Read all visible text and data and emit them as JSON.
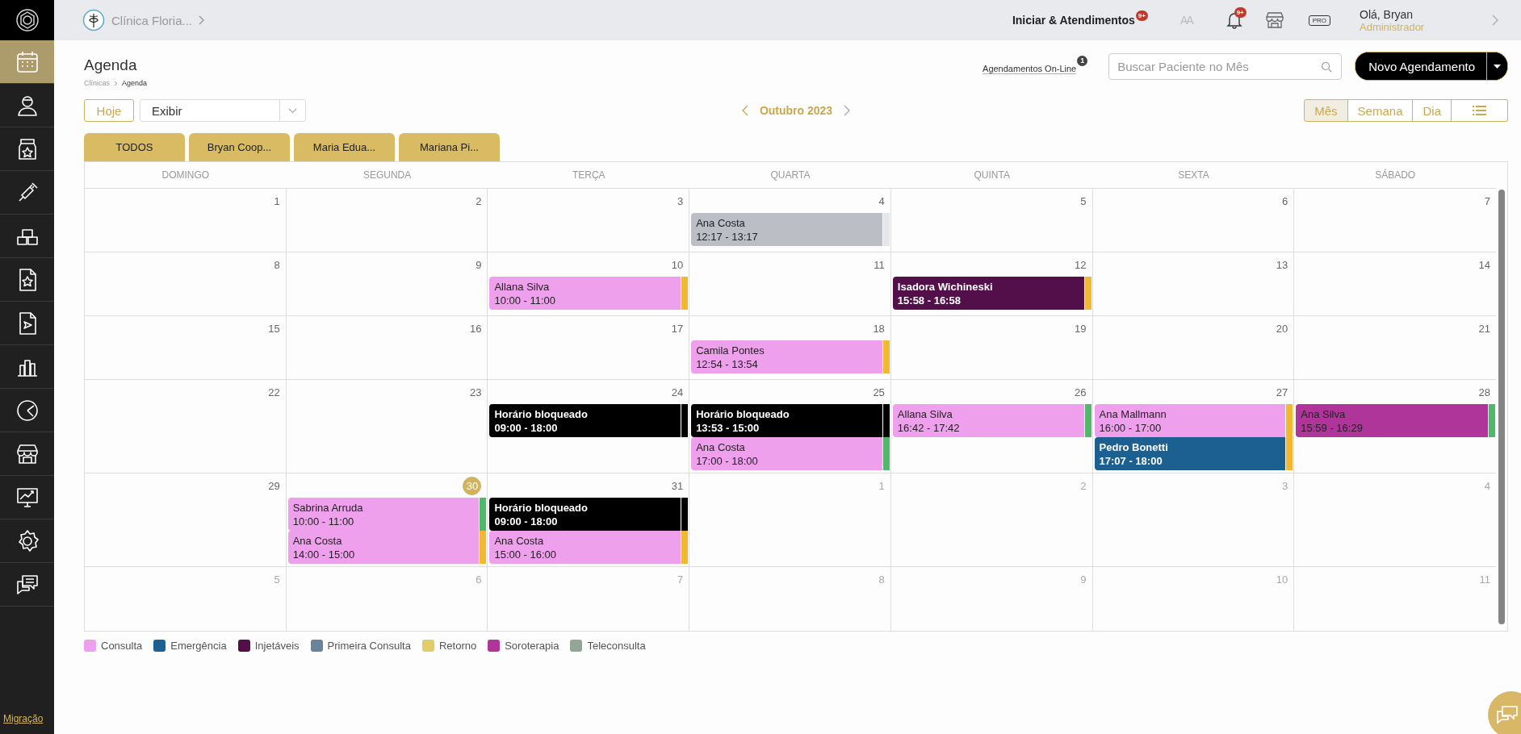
{
  "topbar": {
    "clinic": "Clínica Floria...",
    "start": "Iniciar & Atendimentos",
    "start_badge": "9+",
    "font_size": "AA",
    "bell_badge": "9+",
    "plan": "PRO",
    "greeting": "Olá, Bryan",
    "role": "Administrador"
  },
  "sidebar": {
    "items": [
      {
        "selected": true
      },
      {
        "selected": false
      },
      {
        "selected": false
      },
      {
        "selected": false
      },
      {
        "selected": false
      },
      {
        "selected": false
      },
      {
        "selected": false
      },
      {
        "selected": false
      },
      {
        "selected": false
      },
      {
        "selected": false
      },
      {
        "selected": false
      },
      {
        "selected": false
      },
      {
        "selected": false
      }
    ],
    "migration_link": "Migração"
  },
  "header": {
    "title": "Agenda",
    "breadcrumb": [
      "Clínicas",
      "Agenda"
    ],
    "online_link": "Agendamentos On-Line",
    "online_badge": "1",
    "search": {
      "placeholder": "Buscar Paciente no Mês"
    },
    "new_button": "Novo Agendamento"
  },
  "toolbar": {
    "today": "Hoje",
    "display": "Exibir",
    "month": "Outubro 2023",
    "views": [
      {
        "kind": "text",
        "label": "Mês",
        "selected": true
      },
      {
        "kind": "text",
        "label": "Semana",
        "selected": false
      },
      {
        "kind": "text",
        "label": "Dia",
        "selected": false
      },
      {
        "kind": "list",
        "selected": false
      }
    ]
  },
  "professionals": [
    "TODOS",
    "Bryan Coop...",
    "Maria Edua...",
    "Mariana Pi..."
  ],
  "calendar": {
    "weekdays": [
      "DOMINGO",
      "SEGUNDA",
      "TERÇA",
      "QUARTA",
      "QUINTA",
      "SEXTA",
      "SÁBADO"
    ],
    "weeks": [
      {
        "days": [
          {
            "day": "1",
            "muted": false,
            "today": false
          },
          {
            "day": "2",
            "muted": false,
            "today": false
          },
          {
            "day": "3",
            "muted": false,
            "today": false
          },
          {
            "day": "4",
            "muted": false,
            "today": false,
            "events": [
              {
                "name": "Ana Costa",
                "time": "12:17 - 13:17",
                "color": "#bbbec5",
                "status": {
                  "color": "#e4e6ea"
                }
              }
            ]
          },
          {
            "day": "5",
            "muted": false,
            "today": false
          },
          {
            "day": "6",
            "muted": false,
            "today": false
          },
          {
            "day": "7",
            "muted": false,
            "today": false
          }
        ]
      },
      {
        "days": [
          {
            "day": "8",
            "muted": false,
            "today": false
          },
          {
            "day": "9",
            "muted": false,
            "today": false
          },
          {
            "day": "10",
            "muted": false,
            "today": false,
            "events": [
              {
                "name": "Allana Silva",
                "time": "10:00 - 11:00",
                "color": "#efa0ec",
                "status": {
                  "color": "#f0b930"
                }
              }
            ]
          },
          {
            "day": "11",
            "muted": false,
            "today": false
          },
          {
            "day": "12",
            "muted": false,
            "today": false,
            "events": [
              {
                "name": "Isadora Wichineski",
                "time": "15:58 - 16:58",
                "color": "#520f4a",
                "status": {
                  "color": "#f0b930"
                }
              }
            ]
          },
          {
            "day": "13",
            "muted": false,
            "today": false
          },
          {
            "day": "14",
            "muted": false,
            "today": false
          }
        ]
      },
      {
        "days": [
          {
            "day": "15",
            "muted": false,
            "today": false
          },
          {
            "day": "16",
            "muted": false,
            "today": false
          },
          {
            "day": "17",
            "muted": false,
            "today": false
          },
          {
            "day": "18",
            "muted": false,
            "today": false,
            "events": [
              {
                "name": "Camila Pontes",
                "time": "12:54 - 13:54",
                "color": "#efa0ec",
                "status": {
                  "color": "#f0b930"
                }
              }
            ]
          },
          {
            "day": "19",
            "muted": false,
            "today": false
          },
          {
            "day": "20",
            "muted": false,
            "today": false
          },
          {
            "day": "21",
            "muted": false,
            "today": false
          }
        ]
      },
      {
        "days": [
          {
            "day": "22",
            "muted": false,
            "today": false
          },
          {
            "day": "23",
            "muted": false,
            "today": false
          },
          {
            "day": "24",
            "muted": false,
            "today": false,
            "events": [
              {
                "name": "Horário bloqueado",
                "time": "09:00 - 18:00",
                "color": "#000000",
                "status": {
                  "color": "#000000"
                }
              }
            ]
          },
          {
            "day": "25",
            "muted": false,
            "today": false,
            "events": [
              {
                "name": "Horário bloqueado",
                "time": "13:53 - 15:00",
                "color": "#000000",
                "status": {
                  "color": "#000000"
                }
              },
              {
                "name": "Ana Costa",
                "time": "17:00 - 18:00",
                "color": "#efa0ec",
                "status": {
                  "color": "#4fb86b"
                }
              }
            ]
          },
          {
            "day": "26",
            "muted": false,
            "today": false,
            "events": [
              {
                "name": "Allana Silva",
                "time": "16:42 - 17:42",
                "color": "#efa0ec",
                "status": {
                  "color": "#4fb86b"
                }
              }
            ]
          },
          {
            "day": "27",
            "muted": false,
            "today": false,
            "events": [
              {
                "name": "Ana Mallmann",
                "time": "16:00 - 17:00",
                "color": "#efa0ec",
                "status": {
                  "color": "#f0b930"
                }
              },
              {
                "name": "Pedro Bonetti",
                "time": "17:07 - 18:00",
                "color": "#1c5f91",
                "status": {
                  "color": "#f0b930"
                }
              }
            ]
          },
          {
            "day": "28",
            "muted": false,
            "today": false,
            "events": [
              {
                "name": "Ana Silva",
                "time": "15:59 - 16:29",
                "color": "#b0359a",
                "status": {
                  "color": "#4fb86b"
                }
              }
            ]
          }
        ]
      },
      {
        "days": [
          {
            "day": "29",
            "muted": false,
            "today": false
          },
          {
            "day": "30",
            "muted": false,
            "today": true,
            "events": [
              {
                "name": "Sabrina Arruda",
                "time": "10:00 - 11:00",
                "color": "#efa0ec",
                "status": {
                  "color": "#4fb86b"
                }
              },
              {
                "name": "Ana Costa",
                "time": "14:00 - 15:00",
                "color": "#efa0ec",
                "status": {
                  "color": "#f0b930"
                }
              }
            ]
          },
          {
            "day": "31",
            "muted": false,
            "today": false,
            "events": [
              {
                "name": "Horário bloqueado",
                "time": "09:00 - 18:00",
                "color": "#000000",
                "status": {
                  "color": "#000000"
                }
              },
              {
                "name": "Ana Costa",
                "time": "15:00 - 16:00",
                "color": "#efa0ec",
                "status": {
                  "color": "#f0b930"
                }
              }
            ]
          },
          {
            "day": "1",
            "muted": true,
            "today": false
          },
          {
            "day": "2",
            "muted": true,
            "today": false
          },
          {
            "day": "3",
            "muted": true,
            "today": false
          },
          {
            "day": "4",
            "muted": true,
            "today": false
          }
        ]
      },
      {
        "days": [
          {
            "day": "5",
            "muted": true,
            "today": false
          },
          {
            "day": "6",
            "muted": true,
            "today": false
          },
          {
            "day": "7",
            "muted": true,
            "today": false
          },
          {
            "day": "8",
            "muted": true,
            "today": false
          },
          {
            "day": "9",
            "muted": true,
            "today": false
          },
          {
            "day": "10",
            "muted": true,
            "today": false
          },
          {
            "day": "11",
            "muted": true,
            "today": false
          }
        ]
      }
    ]
  },
  "legend": [
    {
      "label": "Consulta",
      "color": "#efa0ec"
    },
    {
      "label": "Emergência",
      "color": "#1c5f91"
    },
    {
      "label": "Injetáveis",
      "color": "#520f4a"
    },
    {
      "label": "Primeira Consulta",
      "color": "#67849a"
    },
    {
      "label": "Retorno",
      "color": "#e4cc6a"
    },
    {
      "label": "Soroterapia",
      "color": "#b0359a"
    },
    {
      "label": "Teleconsulta",
      "color": "#93a594"
    }
  ]
}
